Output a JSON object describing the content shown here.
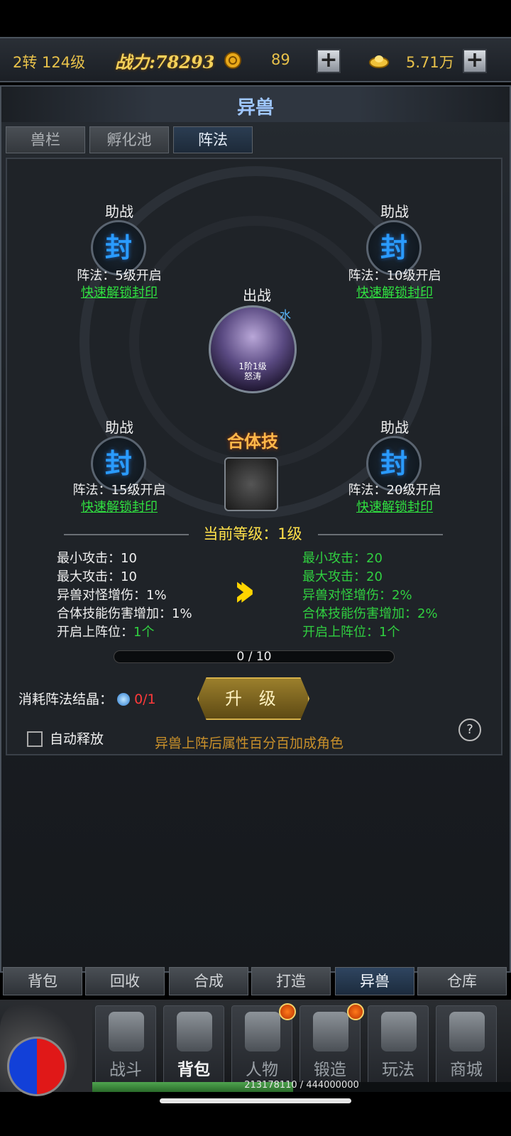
{
  "topbar": {
    "level": "2转 124级",
    "power": "战力:78293",
    "currency1_value": "89",
    "currency2_value": "5.71万",
    "plus": "+"
  },
  "panel": {
    "title": "异兽",
    "tabs": [
      "兽栏",
      "孵化池",
      "阵法"
    ],
    "active_tab": 2
  },
  "formation": {
    "slots": [
      {
        "label": "助战",
        "seal": "封",
        "info": "阵法：5级开启",
        "link": "快速解锁封印"
      },
      {
        "label": "助战",
        "seal": "封",
        "info": "阵法：10级开启",
        "link": "快速解锁封印"
      },
      {
        "label": "助战",
        "seal": "封",
        "info": "阵法：15级开启",
        "link": "快速解锁封印"
      },
      {
        "label": "助战",
        "seal": "封",
        "info": "阵法：20级开启",
        "link": "快速解锁封印"
      }
    ],
    "main": {
      "label": "出战",
      "tier": "1阶1级",
      "name": "怒涛",
      "element": "水"
    },
    "combo_title": "合体技"
  },
  "level": {
    "current": "当前等级：1级"
  },
  "stats": {
    "current": [
      {
        "name": "最小攻击：",
        "value": "10"
      },
      {
        "name": "最大攻击：",
        "value": "10"
      },
      {
        "name": "异兽对怪增伤：",
        "value": "1%"
      },
      {
        "name": "合体技能伤害增加：",
        "value": "1%"
      },
      {
        "name": "开启上阵位：",
        "value": "1个"
      }
    ],
    "next": [
      {
        "name": "最小攻击：",
        "value": "20"
      },
      {
        "name": "最大攻击：",
        "value": "20"
      },
      {
        "name": "异兽对怪增伤：",
        "value": "2%"
      },
      {
        "name": "合体技能伤害增加：",
        "value": "2%"
      },
      {
        "name": "开启上阵位：",
        "value": "1个"
      }
    ]
  },
  "progress": {
    "text": "0 / 10",
    "value": 0,
    "max": 10
  },
  "cost": {
    "label": "消耗阵法结晶：",
    "count": "0/1"
  },
  "upgrade_label": "升 级",
  "auto_release_label": "自动释放",
  "tip": "异兽上阵后属性百分百加成角色",
  "help": "?",
  "bottom_tabs": [
    "背包",
    "回收",
    "合成",
    "打造",
    "异兽",
    "仓库"
  ],
  "nav": [
    "战斗",
    "背包",
    "人物",
    "锻造",
    "玩法",
    "商城"
  ],
  "exp": {
    "text": "213178110 / 444000000",
    "current": 213178110,
    "max": 444000000
  },
  "colors": {
    "gold": "#e8c14a",
    "green": "#30d040",
    "seal_blue": "#2a9bff",
    "red": "#ff3a3a"
  }
}
